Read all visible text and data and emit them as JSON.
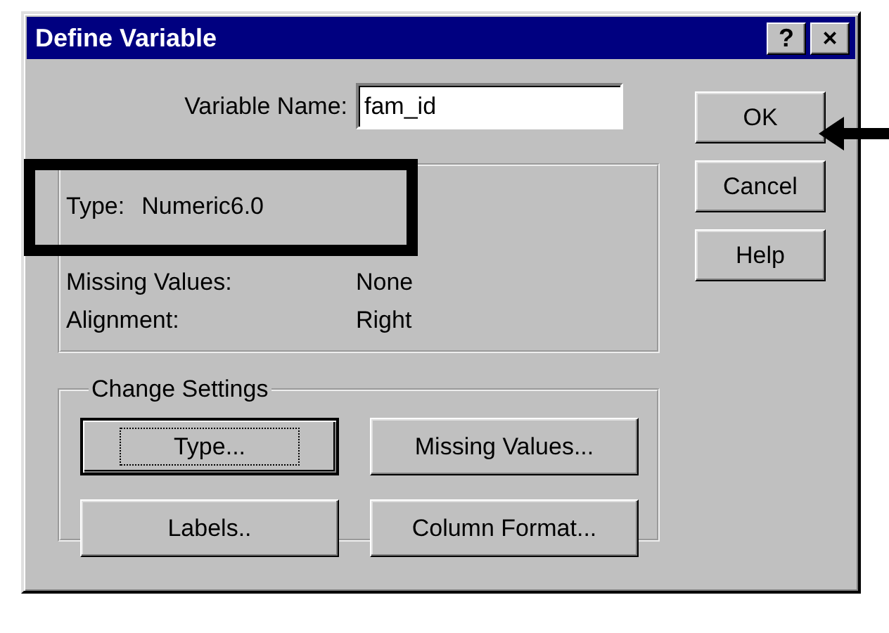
{
  "window": {
    "title": "Define Variable",
    "title_buttons": [
      "?",
      "×"
    ]
  },
  "variable_name": {
    "label": "Variable Name:",
    "value": "fam_id"
  },
  "description": {
    "rows": [
      {
        "label": "Type:",
        "value": "Numeric6.0",
        "kind": "inline"
      },
      {
        "label": "Missing Values:",
        "value": "None",
        "kind": "column"
      },
      {
        "label": "Alignment:",
        "value": "Right",
        "kind": "column"
      }
    ]
  },
  "change_settings": {
    "legend": "Change Settings",
    "buttons": [
      {
        "label": "Type...",
        "focused": true
      },
      {
        "label": "Missing Values...",
        "focused": false
      },
      {
        "label": "Labels..",
        "focused": false
      },
      {
        "label": "Column Format...",
        "focused": false
      }
    ]
  },
  "buttons": [
    "OK",
    "Cancel",
    "Help"
  ],
  "annotations": {
    "highlight_frame": true,
    "pointer_arrow": true
  }
}
